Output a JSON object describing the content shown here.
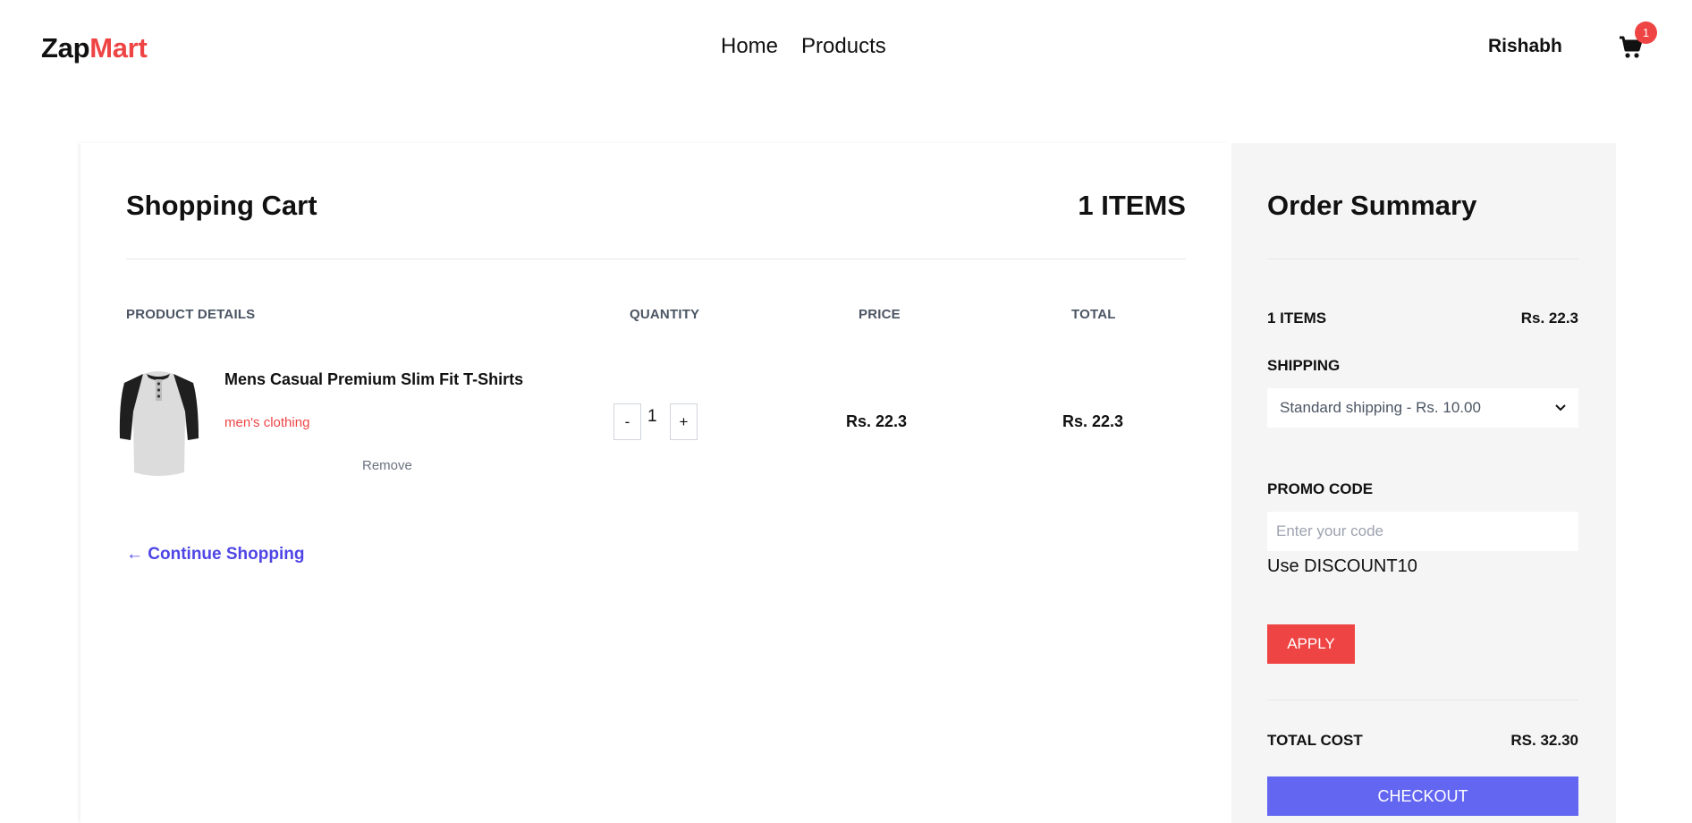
{
  "header": {
    "logo_part1": "Zap",
    "logo_part2": "Mart",
    "nav": [
      "Home",
      "Products"
    ],
    "user_name": "Rishabh",
    "cart_badge": "1",
    "cart_icon": "shopping-cart-icon"
  },
  "cart": {
    "title": "Shopping Cart",
    "item_count": "1 ITEMS",
    "columns": [
      "PRODUCT DETAILS",
      "QUANTITY",
      "PRICE",
      "TOTAL"
    ],
    "items": [
      {
        "name": "Mens Casual Premium Slim Fit T-Shirts",
        "category": "men's clothing",
        "remove_label": "Remove",
        "quantity": "1",
        "decrement": "-",
        "increment": "+",
        "price": "Rs. 22.3",
        "total": "Rs. 22.3"
      }
    ],
    "continue_label": "← Continue Shopping"
  },
  "summary": {
    "title": "Order Summary",
    "items_label": "1 ITEMS",
    "items_value": "Rs. 22.3",
    "shipping_label": "SHIPPING",
    "shipping_selected": "Standard shipping - Rs. 10.00",
    "promo_label": "PROMO CODE",
    "promo_placeholder": "Enter your code",
    "promo_hint": "Use DISCOUNT10",
    "apply_label": "APPLY",
    "total_label": "TOTAL COST",
    "total_value": "RS. 32.30",
    "checkout_label": "CHECKOUT"
  },
  "colors": {
    "accent_red": "#ef4444",
    "link_indigo": "#4f46e5",
    "checkout": "#6366f1",
    "summary_bg": "#f5f5f5"
  }
}
